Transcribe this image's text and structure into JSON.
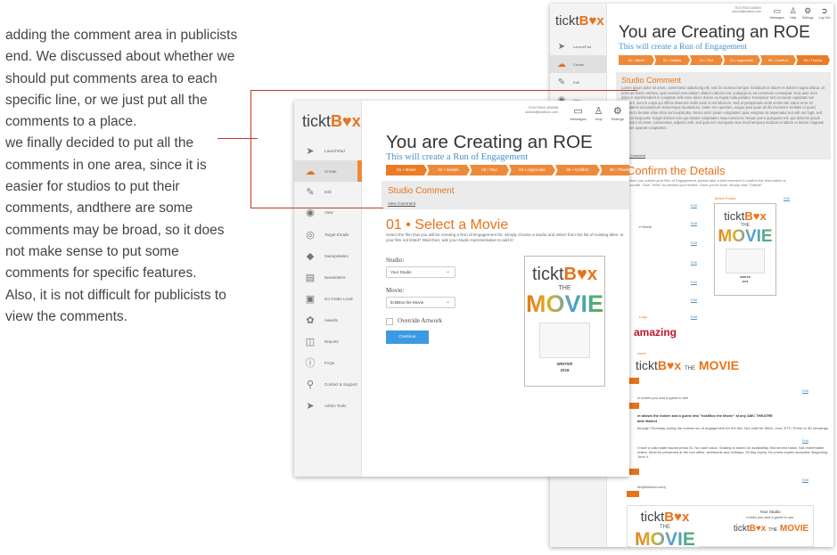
{
  "notes": [
    "adding the comment area in publicists",
    "end. We discussed about whether we",
    "should put comments area to each",
    "specific line, or we just put all the",
    "comments to a place.",
    "we finally decided to put all the",
    "comments in one area, since it is",
    "easier for studios to put their",
    "comments, andthere are some",
    "comments may be broad, so it does",
    "not make sense to put some",
    "comments for specific features.",
    "Also, it is not difficult for publicists to",
    "view the comments."
  ],
  "app": {
    "logo_text": "tickt",
    "logo_mark": "B♥x",
    "user_name": "TICKTBOX ADMIN",
    "user_email": "admin@ticktbox.com",
    "toolbar": [
      "Messages",
      "Help",
      "Settings",
      "Log Out"
    ]
  },
  "sidebar": [
    {
      "label": "LaunchPad",
      "icon": "rocket-icon"
    },
    {
      "label": "Create",
      "icon": "cloud-create-icon",
      "active": true
    },
    {
      "label": "Edit",
      "icon": "edit-icon"
    },
    {
      "label": "View",
      "icon": "eye-icon"
    },
    {
      "label": "Target Emails",
      "icon": "target-icon"
    },
    {
      "label": "Sweepstakes",
      "icon": "ticket-icon"
    },
    {
      "label": "Newsletters",
      "icon": "newsletter-icon"
    },
    {
      "label": "Go Grabs Local",
      "icon": "local-icon"
    },
    {
      "label": "Awards",
      "icon": "award-icon"
    },
    {
      "label": "Reports",
      "icon": "reports-icon"
    },
    {
      "label": "FAQs",
      "icon": "help-icon"
    },
    {
      "label": "Contact & Support",
      "icon": "support-icon"
    },
    {
      "label": "Admin Tools",
      "icon": "tools-icon"
    }
  ],
  "page": {
    "title": "You are Creating an ROE",
    "subtitle": "This will create a Run of Engagement",
    "steps": [
      "01 • Movie",
      "02 • Details",
      "03 • Text",
      "04 • Approvals",
      "05 • Confirm",
      "06 • Thanks"
    ]
  },
  "front": {
    "comment_title": "Studio Comment",
    "comment_link": "View Comment",
    "section_title": "01 • Select a Movie",
    "section_desc": "Select the film that you will be creating a Run of Engagement for. Simply choose a studio and select from the list of existing titles. Is your film not listed? Wait then, ask your studio representative to add it!",
    "studio_label": "Studio:",
    "studio_value": "Your Studio",
    "movie_label": "Movie:",
    "movie_value": "ticktBox the Movie",
    "override_label": "Override Artwork",
    "continue_label": "Continue"
  },
  "poster": {
    "the": "THE",
    "movie": "MOVIE",
    "winter": "WINTER",
    "year": "2018"
  },
  "back": {
    "comment_title": "Studio Comment",
    "comment_text": "Lorem ipsum dolor sit amet, consectetur adipiscing elit, sed do eiusmod tempor incididunt ut labore et dolore magna aliqua. Ut enim ad minim veniam, quis nostrud exercitation ullamco laboris nisi ut aliquip ex ea commodo consequat. Duis aute irure dolor in reprehenderit in voluptate velit esse cillum dolore eu fugiat nulla pariatur. Excepteur sint occaecat cupidatat non proident, sunt in culpa qui officia deserunt mollit anim id est laborum. Sed ut perspiciatis unde omnis iste natus error sit voluptatem accusantium doloremque laudantium, totam rem aperiam, eaque ipsa quae ab illo inventore veritatis et quasi architecto beatae vitae dicta sunt explicabo. Nemo enim ipsam voluptatem quia voluptas sit aspernatur aut odit aut fugit, sed quia consequuntur magni dolores eos qui ratione voluptatem sequi nesciunt. Neque porro quisquam est, qui dolorem ipsum quia dolor sit amet, consectetur, adipisci velit, sed quia non numquam eius modi tempora incidunt ut labore et dolore magnam aliquam quaerat voluptatem.",
    "comment_link": "View Comment",
    "details_title": "Confirm the Details",
    "details_desc": "Before you submit your Run of Engagement, please take a brief moment to confirm the information is accurate. Click \"View\" to preview your tickets. Once you're done, simply click \"Submit\"",
    "poster_label": "Movie Poster:",
    "edit": "Edit",
    "frag_movie": "e Movie",
    "frag_logo": "Logo",
    "amazing": "amazing",
    "frag_comment": "ment:",
    "invite_text": "io invites you and a guest to see",
    "allows_text": "et allows the holder and a guest into \"ticktBox the Movie\" at any AMC THEATRE",
    "allows_text2": "able Market",
    "allows_text3": "through Thursday during the normal run of engagement for the film. Not valid for IMAX, ema, ETX, Prime or 3D showings.",
    "terms_text": "t have a valid state issued photo ID. No cash value. Seating is based on availability, first served basis. Not redeemable online. Must be presented at the box office. weekends and holidays. 30 day expiry. No photo copies accepted. Beginning June 4.",
    "email_text": "nb@ticktbox.com)",
    "studio_text": "Your Studio",
    "studio_invites": "invites you and a guest to see"
  }
}
